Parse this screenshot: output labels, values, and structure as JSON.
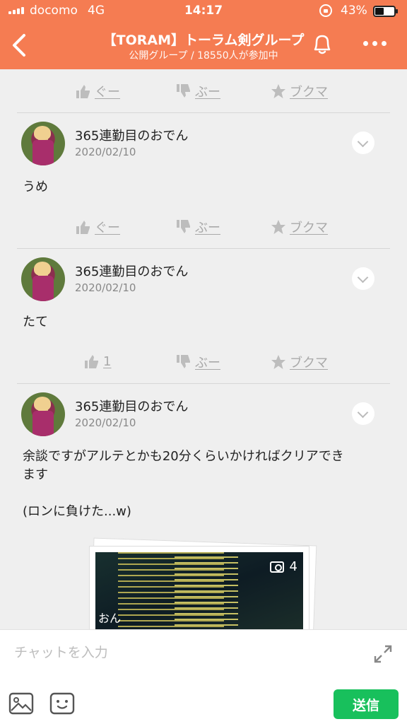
{
  "status": {
    "carrier": "docomo",
    "network": "4G",
    "time": "14:17",
    "battery": "43%"
  },
  "header": {
    "title": "【TORAM】トーラム剣グループ",
    "subtitle": "公開グループ / 18550人が参加中"
  },
  "colors": {
    "header": "#f57c52",
    "send": "#18c05c"
  },
  "actions_top": {
    "good": "ぐー",
    "boo": "ぶー",
    "bookmark": "ブクマ"
  },
  "posts": [
    {
      "author": "365連勤目のおでん",
      "date": "2020/02/10",
      "text": "うめ",
      "actions": {
        "good": "ぐー",
        "boo": "ぶー",
        "bookmark": "ブクマ"
      }
    },
    {
      "author": "365連勤目のおでん",
      "date": "2020/02/10",
      "text": "たて",
      "actions": {
        "good": "1",
        "boo": "ぶー",
        "bookmark": "ブクマ"
      }
    },
    {
      "author": "365連勤目のおでん",
      "date": "2020/02/10",
      "text_line1": "余談ですがアルテとかも20分くらいかければクリアでき",
      "text_line2": "ます",
      "text_line3": "(ロンに負けた...w)",
      "photo": {
        "count": "4",
        "overlay": "おん"
      }
    }
  ],
  "composer": {
    "placeholder": "チャットを入力",
    "send_label": "送信"
  }
}
